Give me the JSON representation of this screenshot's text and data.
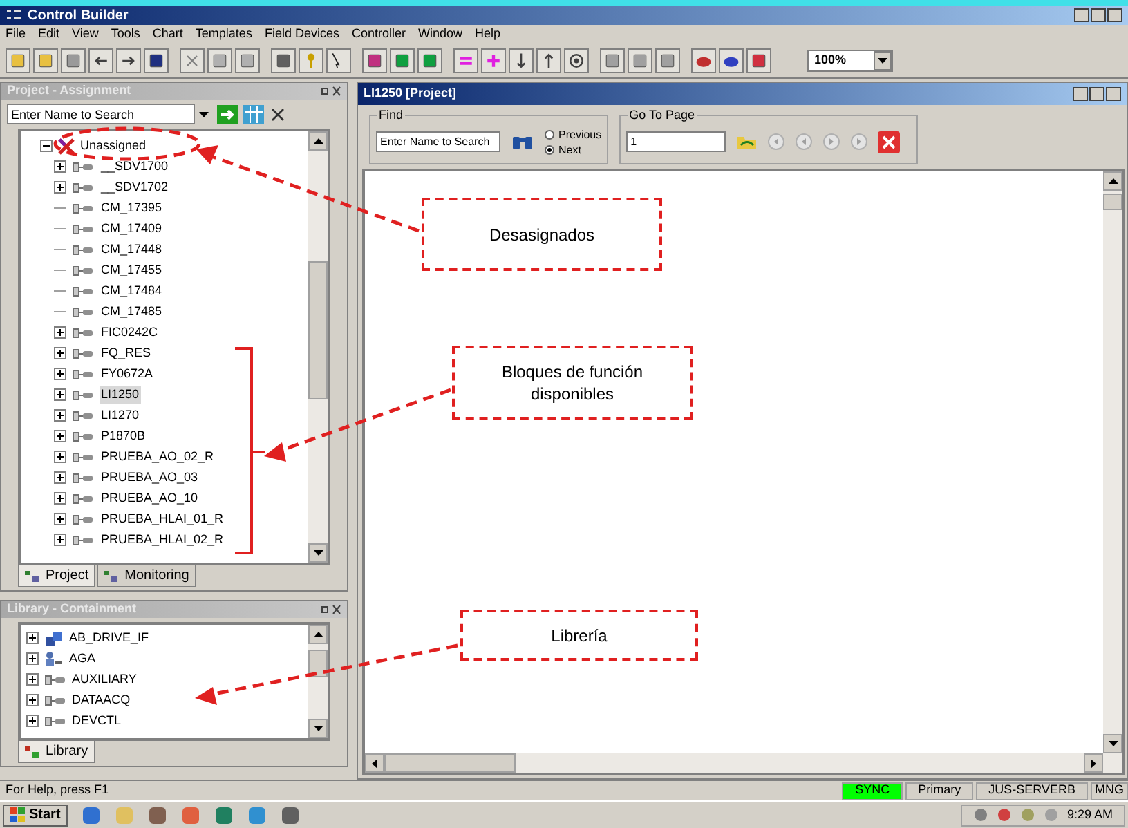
{
  "window": {
    "title": "Control Builder"
  },
  "menu": [
    "File",
    "Edit",
    "View",
    "Tools",
    "Chart",
    "Templates",
    "Field Devices",
    "Controller",
    "Window",
    "Help"
  ],
  "zoom": {
    "value": "100%"
  },
  "project_panel": {
    "title": "Project - Assignment",
    "search": {
      "placeholder": "Enter Name to Search"
    },
    "tree": {
      "label": "Unassigned",
      "expanded": true,
      "children": [
        {
          "label": "__SDV1700",
          "expandable": true,
          "selected": false
        },
        {
          "label": "__SDV1702",
          "expandable": true,
          "selected": false
        },
        {
          "label": "CM_17395",
          "expandable": false,
          "selected": false
        },
        {
          "label": "CM_17409",
          "expandable": false,
          "selected": false
        },
        {
          "label": "CM_17448",
          "expandable": false,
          "selected": false
        },
        {
          "label": "CM_17455",
          "expandable": false,
          "selected": false
        },
        {
          "label": "CM_17484",
          "expandable": false,
          "selected": false
        },
        {
          "label": "CM_17485",
          "expandable": false,
          "selected": false
        },
        {
          "label": "FIC0242C",
          "expandable": true,
          "selected": false
        },
        {
          "label": "FQ_RES",
          "expandable": true,
          "selected": false
        },
        {
          "label": "FY0672A",
          "expandable": true,
          "selected": false
        },
        {
          "label": "LI1250",
          "expandable": true,
          "selected": true
        },
        {
          "label": "LI1270",
          "expandable": true,
          "selected": false
        },
        {
          "label": "P1870B",
          "expandable": true,
          "selected": false
        },
        {
          "label": "PRUEBA_AO_02_R",
          "expandable": true,
          "selected": false
        },
        {
          "label": "PRUEBA_AO_03",
          "expandable": true,
          "selected": false
        },
        {
          "label": "PRUEBA_AO_10",
          "expandable": true,
          "selected": false
        },
        {
          "label": "PRUEBA_HLAI_01_R",
          "expandable": true,
          "selected": false
        },
        {
          "label": "PRUEBA_HLAI_02_R",
          "expandable": true,
          "selected": false
        }
      ]
    },
    "tabs": [
      {
        "label": "Project",
        "selected": true
      },
      {
        "label": "Monitoring",
        "selected": false
      }
    ]
  },
  "library_panel": {
    "title": "Library - Containment",
    "items": [
      {
        "label": "AB_DRIVE_IF",
        "kind": "device"
      },
      {
        "label": "AGA",
        "kind": "group"
      },
      {
        "label": "AUXILIARY",
        "kind": "block"
      },
      {
        "label": "DATAACQ",
        "kind": "block"
      },
      {
        "label": "DEVCTL",
        "kind": "block"
      }
    ],
    "tabs": [
      {
        "label": "Library",
        "selected": true
      }
    ]
  },
  "child_window": {
    "title": "LI1250 [Project]",
    "find": {
      "label": "Find",
      "placeholder": "Enter Name to Search",
      "options": [
        {
          "label": "Previous",
          "selected": false
        },
        {
          "label": "Next",
          "selected": true
        }
      ]
    },
    "go_to_page": {
      "label": "Go To Page",
      "value": "1"
    }
  },
  "annotations": [
    {
      "text": "Desasignados"
    },
    {
      "text": "Bloques de función disponibles"
    },
    {
      "text": "Librería"
    }
  ],
  "status_bar": {
    "help": "For Help, press F1",
    "panes": [
      {
        "text": "SYNC",
        "color": "#00ff00"
      },
      {
        "text": "Primary",
        "color": "#d4d0c8"
      },
      {
        "text": "JUS-SERVERB",
        "color": "#d4d0c8"
      },
      {
        "text": "MNG",
        "color": "#d4d0c8"
      }
    ]
  },
  "taskbar": {
    "start": "Start",
    "time": "9:29 AM"
  }
}
